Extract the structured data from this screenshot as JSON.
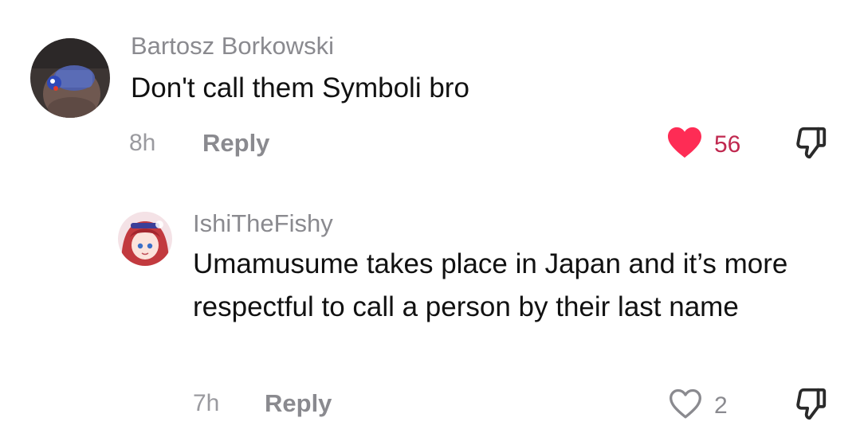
{
  "comments": [
    {
      "username": "Bartosz Borkowski",
      "text": "Don't call them Symboli bro",
      "time": "8h",
      "reply_label": "Reply",
      "likes": "56",
      "liked": true
    },
    {
      "username": "IshiTheFishy",
      "text": "Umamusume takes place in Japan and it’s more respectful to call a person by their last name",
      "time": "7h",
      "reply_label": "Reply",
      "likes": "2",
      "liked": false
    }
  ],
  "colors": {
    "like_active": "#fe2c55",
    "icon_gray": "#8a8a8f",
    "text_primary": "#111111",
    "text_secondary": "#8a8a8f"
  },
  "icons": {
    "like_active": "heart-filled-icon",
    "like_inactive": "heart-outline-icon",
    "dislike": "thumbs-down-icon"
  }
}
